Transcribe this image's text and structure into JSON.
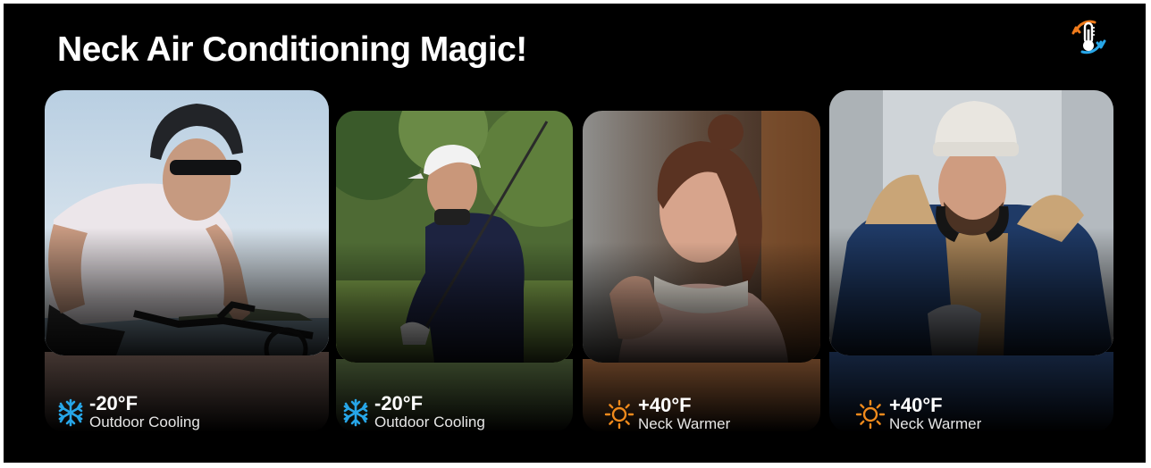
{
  "banner": {
    "title": "Neck Air Conditioning Magic!",
    "icon": "thermometer-icon"
  },
  "cards": [
    {
      "photo": "cyclist wearing neck cooler",
      "mode_icon": "snowflake-icon",
      "temperature": "-20°F",
      "mode_label": "Outdoor Cooling",
      "accent_color": "#27a6e8"
    },
    {
      "photo": "golfer wearing neck cooler",
      "mode_icon": "snowflake-icon",
      "temperature": "-20°F",
      "mode_label": "Outdoor Cooling",
      "accent_color": "#27a6e8"
    },
    {
      "photo": "woman wearing white neck warmer",
      "mode_icon": "sun-icon",
      "temperature": "+40°F",
      "mode_label": "Neck Warmer",
      "accent_color": "#f08a1c"
    },
    {
      "photo": "man in winter parka wearing neck warmer",
      "mode_icon": "sun-icon",
      "temperature": "+40°F",
      "mode_label": "Neck Warmer",
      "accent_color": "#f08a1c"
    }
  ]
}
